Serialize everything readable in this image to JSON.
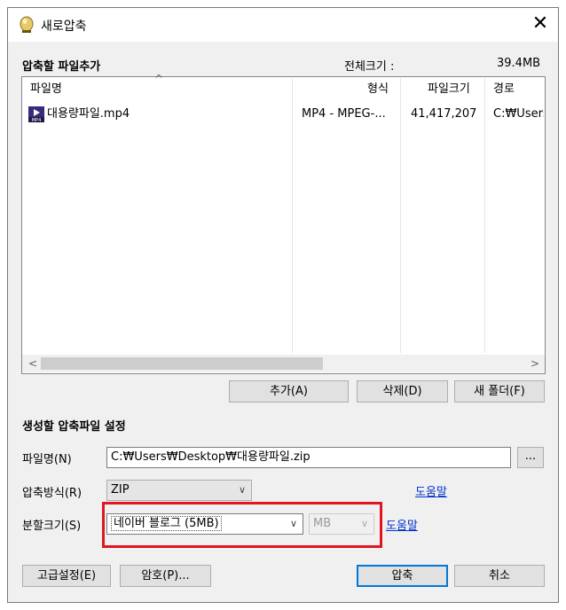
{
  "window": {
    "title": "새로압축",
    "close_symbol": "✕"
  },
  "add_files": {
    "section_title": "압축할 파일추가",
    "total_size_label": "전체크기 :",
    "total_size_value": "39.4MB",
    "columns": {
      "name": "파일명",
      "type": "형식",
      "size": "파일크기",
      "path": "경로"
    },
    "sort_indicator": "^",
    "rows": [
      {
        "name": "대용량파일.mp4",
        "type": "MP4 - MPEG-...",
        "size": "41,417,207",
        "path": "C:₩Users"
      }
    ],
    "scroll_left": "<",
    "scroll_right": ">",
    "buttons": {
      "add": "추가(A)",
      "delete": "삭제(D)",
      "new_folder": "새 폴더(F)"
    }
  },
  "archive_settings": {
    "section_title": "생성할 압축파일 설정",
    "filename_label": "파일명(N)",
    "filename_value": "C:₩Users₩Desktop₩대용량파일.zip",
    "browse_label": "...",
    "method_label": "압축방식(R)",
    "method_value": "ZIP",
    "help_label": "도움말",
    "split_label": "분할크기(S)",
    "split_value": "네이버 블로그 (5MB)",
    "unit_value": "MB",
    "chevron": "∨"
  },
  "footer": {
    "advanced": "고급설정(E)",
    "password": "암호(P)...",
    "compress": "압축",
    "cancel": "취소"
  },
  "colors": {
    "highlight": "#e0171f",
    "link": "#0033cc",
    "default_button_border": "#0078d7"
  }
}
